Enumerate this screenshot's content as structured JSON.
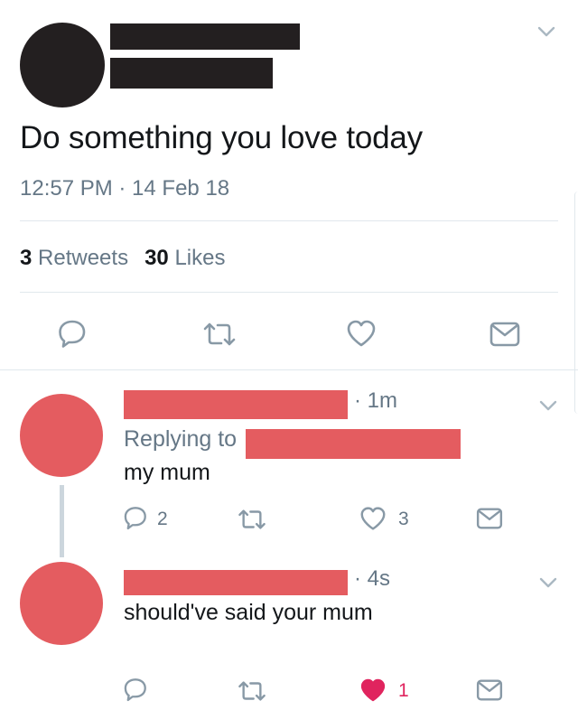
{
  "main_tweet": {
    "text": "Do something you love today",
    "timestamp": "12:57 PM · 14 Feb 18",
    "retweets_count": "3",
    "retweets_label": "Retweets",
    "likes_count": "30",
    "likes_label": "Likes"
  },
  "replies": [
    {
      "time": "· 1m",
      "replying_label": "Replying to",
      "text": "my mum",
      "reply_count": "2",
      "like_count": "3"
    },
    {
      "time": "· 4s",
      "text": "should've said your mum",
      "like_count": "1",
      "liked": true
    }
  ],
  "icons": [
    "chevron-down-icon",
    "reply-icon",
    "retweet-icon",
    "heart-icon",
    "direct-message-icon"
  ],
  "colors": {
    "redaction_black": "#231f20",
    "redaction_red": "#e45c60",
    "muted_text": "#657786",
    "icon_gray": "#8899a6",
    "like_red": "#e0245e",
    "divider": "#e1e8ed"
  }
}
